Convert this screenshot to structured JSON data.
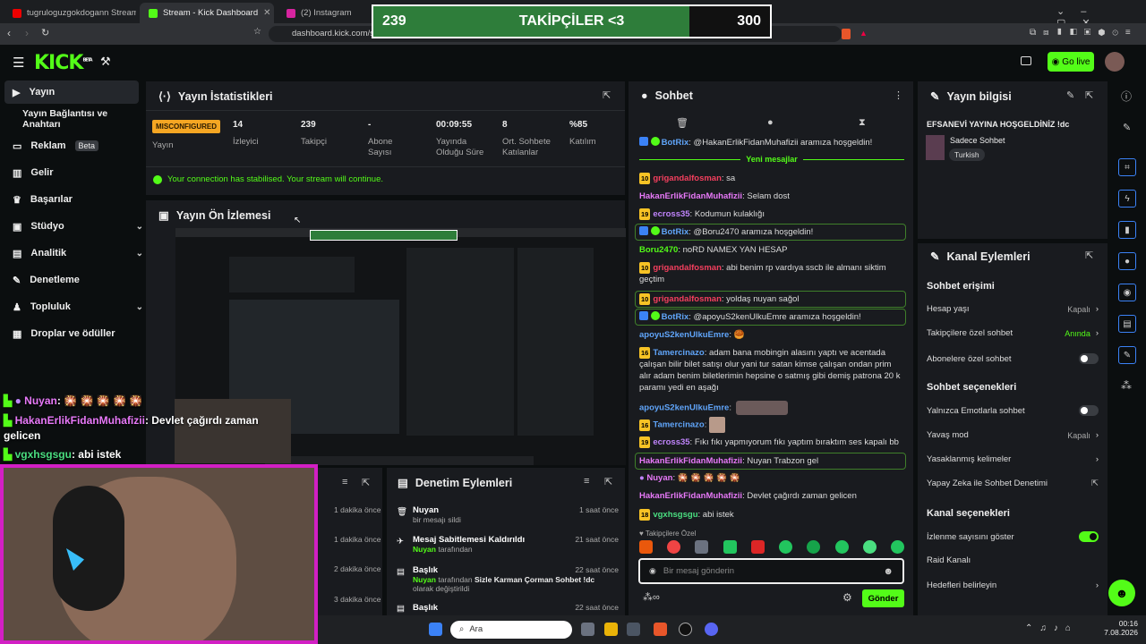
{
  "browser": {
    "tabs": [
      {
        "title": "tugruloguzgokdogann Stream - Y"
      },
      {
        "title": "Stream - Kick Dashboard"
      },
      {
        "title": "(2) Instagram"
      }
    ],
    "url": "dashboard.kick.com/str"
  },
  "goal": {
    "current": "239",
    "label": "TAKİPÇİLER <3",
    "target": "300",
    "progress": 0.797
  },
  "header": {
    "logo": "KICK",
    "logo_sup": "BETA",
    "go_live": "Go live"
  },
  "sidebar": {
    "items": [
      {
        "label": "Yayın"
      },
      {
        "label": "Yayın Bağlantısı ve Anahtarı"
      },
      {
        "label": "Reklam",
        "badge": "Beta"
      },
      {
        "label": "Gelir"
      },
      {
        "label": "Başarılar"
      },
      {
        "label": "Stüdyo"
      },
      {
        "label": "Analitik"
      },
      {
        "label": "Denetleme"
      },
      {
        "label": "Topluluk"
      },
      {
        "label": "Droplar ve ödüller"
      }
    ]
  },
  "stats": {
    "title": "Yayın İstatistikleri",
    "status_badge": "MISCONFIGURED",
    "status_label": "Yayın",
    "items": [
      {
        "value": "14",
        "label": "İzleyici"
      },
      {
        "value": "239",
        "label": "Takipçi"
      },
      {
        "value": "-",
        "label": "Abone Sayısı"
      },
      {
        "value": "00:09:55",
        "label": "Yayında Olduğu Süre"
      },
      {
        "value": "8",
        "label": "Ort. Sohbete Katılanlar"
      },
      {
        "value": "%85",
        "label": "Katılım"
      }
    ],
    "notice": "Your connection has stabilised. Your stream will continue."
  },
  "preview": {
    "title": "Yayın Ön İzlemesi"
  },
  "overlay_chat": [
    {
      "user": "Nuyan",
      "text": ": 🎇 🎇 🎇 🎇 🎇"
    },
    {
      "user": "HakanErlikFidanMuhafizii",
      "text": ": Devlet çağırdı zaman gelicen"
    },
    {
      "user": "vgxhsgsgu",
      "text": ": abi istek"
    }
  ],
  "times": [
    "1 dakika önce",
    "1 dakika önce",
    "2 dakika önce",
    "3 dakika önce"
  ],
  "moderation": {
    "title": "Denetim Eylemleri",
    "items": [
      {
        "title": "Nuyan",
        "sub": "bir mesajı sildi",
        "time": "1 saat önce"
      },
      {
        "title": "Mesaj Sabitlemesi Kaldırıldı",
        "sub_user": "Nuyan",
        "sub": " tarafından",
        "time": "21 saat önce"
      },
      {
        "title": "Başlık",
        "sub_user": "Nuyan",
        "sub": " tarafından ",
        "sub_bold": "Sizle Karman Çorman Sohbet !dc",
        "sub_end": " olarak değiştirildi",
        "time": "22 saat önce"
      },
      {
        "title": "Başlık",
        "time": "22 saat önce"
      }
    ]
  },
  "chat": {
    "title": "Sohbet",
    "new_messages": "Yeni mesajlar",
    "messages": [
      {
        "user": "BotRix",
        "text": "@HakanErlikFidanMuhafizii aramıza hoşgeldin!"
      },
      {
        "level": "10",
        "user": "grigandalfosman",
        "text": "sa"
      },
      {
        "user": "HakanErlikFidanMuhafizii",
        "text": "Selam dost"
      },
      {
        "level": "19",
        "user": "ecross35",
        "text": "Kodumun kulaklığı"
      },
      {
        "user": "BotRix",
        "text": "@Boru2470 aramıza hoşgeldin!"
      },
      {
        "user": "Boru2470",
        "text": "noRD NAMEX YAN HESAP"
      },
      {
        "level": "10",
        "user": "grigandalfosman",
        "text": "abi benim rp vardıya sscb ile almanı siktim geçtim"
      },
      {
        "level": "10",
        "user": "grigandalfosman",
        "text": "yoldaş nuyan sağol"
      },
      {
        "user": "BotRix",
        "text": "@apoyuS2kenUlkuEmre aramıza hoşgeldin!"
      },
      {
        "user": "apoyuS2kenUlkuEmre",
        "text": "🥮"
      },
      {
        "level": "16",
        "user": "Tamercinazo",
        "text": "adam bana mobingin alasını yaptı ve acentada çalışan bilir bilet satışı olur yani tur satan kimse çalışan ondan prim alır adam benim biletlerimin hepsine o satmış gibi demiş patrona 20 k paramı yedi en aşağı"
      },
      {
        "user": "apoyuS2kenUlkuEmre",
        "text": ""
      },
      {
        "level": "16",
        "user": "Tamercinazo",
        "text": ""
      },
      {
        "level": "19",
        "user": "ecross35",
        "text": "Fıkı fıkı yapmıyorum fıkı yaptım bıraktım ses kapalı bb"
      },
      {
        "user": "HakanErlikFidanMuhafizii",
        "text": "Nuyan Trabzon gel"
      },
      {
        "user": "Nuyan",
        "text": "🎇 🎇 🎇 🎇 🎇"
      },
      {
        "user": "HakanErlikFidanMuhafizii",
        "text": "Devlet çağırdı zaman gelicen"
      },
      {
        "level": "18",
        "user": "vgxhsgsgu",
        "text": "abi istek"
      }
    ],
    "emote_tab": "Takipçilere Özel",
    "input_placeholder": "Bir mesaj gönderin",
    "send": "Gönder"
  },
  "info": {
    "title": "Yayın bilgisi",
    "stream_title": "EFSANEVİ YAYINA HOŞGELDİNİZ !dc",
    "category": "Sadece Sohbet",
    "tag": "Turkish"
  },
  "channel_actions": {
    "title": "Kanal Eylemleri",
    "sections": [
      {
        "heading": "Sohbet erişimi"
      },
      {
        "heading": "Sohbet seçenekleri"
      },
      {
        "heading": "Kanal seçenekleri"
      }
    ],
    "rows": [
      {
        "label": "Hesap yaşı",
        "value": "Kapalı"
      },
      {
        "label": "Takipçilere özel sohbet",
        "value": "Anında"
      },
      {
        "label": "Abonelere özel sohbet"
      },
      {
        "label": "Yalnızca Emotlarla sohbet"
      },
      {
        "label": "Yavaş mod",
        "value": "Kapalı"
      },
      {
        "label": "Yasaklanmış kelimeler"
      },
      {
        "label": "Yapay Zeka ile Sohbet Denetimi"
      },
      {
        "label": "İzlenme sayısını göster"
      },
      {
        "label": "Raid Kanalı"
      },
      {
        "label": "Hedefleri belirleyin"
      }
    ]
  },
  "taskbar": {
    "search": "Ara",
    "time": "00:16",
    "date": "7.08.2026"
  },
  "colors": {
    "kick_green": "#53fc18",
    "panel": "#191b1f",
    "bg": "#0b0e0f",
    "webcam_border": "#d21fc4"
  }
}
